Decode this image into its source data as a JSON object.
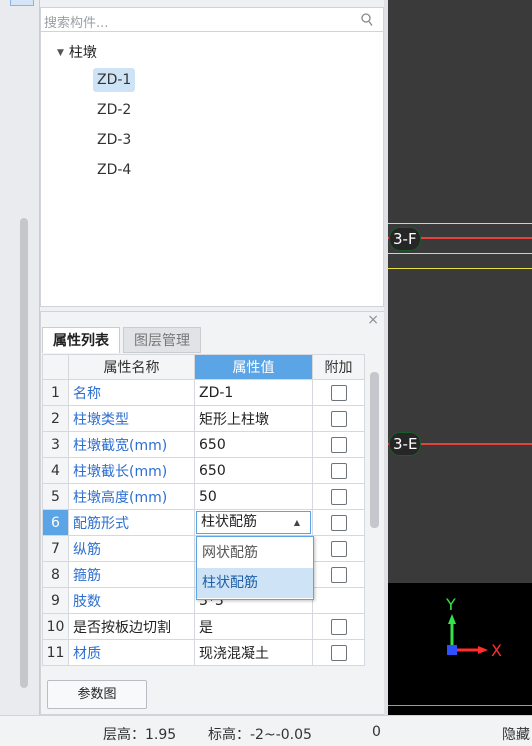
{
  "search": {
    "placeholder": "搜索构件..."
  },
  "tree": {
    "root_label": "柱墩",
    "items": [
      "ZD-1",
      "ZD-2",
      "ZD-3",
      "ZD-4"
    ],
    "selected": "ZD-1"
  },
  "panel": {
    "tabs": [
      "属性列表",
      "图层管理"
    ],
    "active_tab": "属性列表",
    "close_glyph": "×"
  },
  "table": {
    "headers": {
      "index": "",
      "name": "属性名称",
      "value": "属性值",
      "extra": "附加"
    },
    "rows": [
      {
        "num": "1",
        "name": "名称",
        "value": "ZD-1",
        "checkbox": true
      },
      {
        "num": "2",
        "name": "柱墩类型",
        "value": "矩形上柱墩",
        "checkbox": true
      },
      {
        "num": "3",
        "name": "柱墩截宽(mm)",
        "value": "650",
        "checkbox": true
      },
      {
        "num": "4",
        "name": "柱墩截长(mm)",
        "value": "650",
        "checkbox": true
      },
      {
        "num": "5",
        "name": "柱墩高度(mm)",
        "value": "50",
        "checkbox": true
      },
      {
        "num": "6",
        "name": "配筋形式",
        "value": "柱状配筋",
        "checkbox": true
      },
      {
        "num": "7",
        "name": "纵筋",
        "value": "",
        "checkbox": true
      },
      {
        "num": "8",
        "name": "箍筋",
        "value": "",
        "checkbox": true
      },
      {
        "num": "9",
        "name": "肢数",
        "value": "3*3",
        "checkbox": false
      },
      {
        "num": "10",
        "name": "是否按板边切割",
        "value": "是",
        "checkbox": true
      },
      {
        "num": "11",
        "name": "材质",
        "value": "现浇混凝土",
        "checkbox": true
      }
    ]
  },
  "dropdown": {
    "options": [
      "网状配筋",
      "柱状配筋"
    ],
    "selected": "柱状配筋"
  },
  "buttons": {
    "param_diagram": "参数图"
  },
  "viewport": {
    "axis_labels": [
      "3-F",
      "3-E"
    ],
    "ucs": {
      "y": "Y",
      "x": "X"
    }
  },
  "status_bar": {
    "floor_height": "层高：1.95",
    "elevation": "标高：-2~-0.05",
    "count": "0",
    "hide": "隐藏"
  },
  "colors": {
    "accent": "#5ba4e6",
    "link_blue": "#2d6fd0",
    "axis_red": "#e8403a",
    "axis_yellow": "#e8e03a",
    "ucs_green": "#34e24a",
    "ucs_red": "#ff2d2d",
    "ucs_blue": "#3050ff"
  }
}
